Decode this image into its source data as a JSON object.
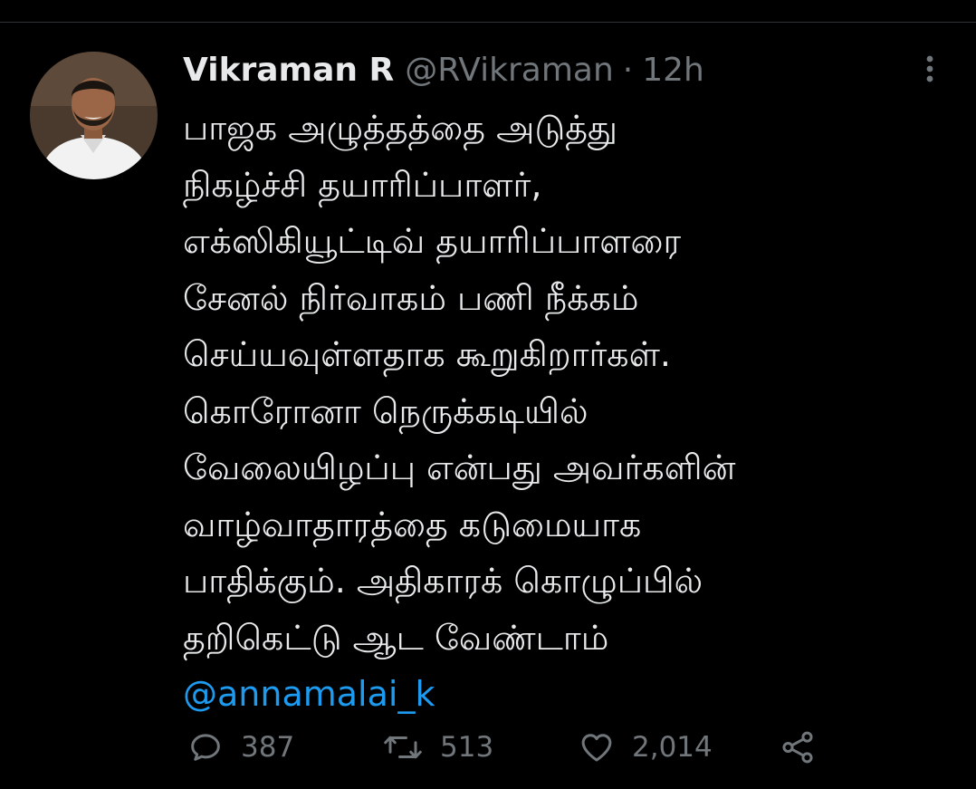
{
  "tweet": {
    "author": {
      "display_name": "Vikraman R",
      "handle": "@RVikraman",
      "avatar_icon": "profile-photo"
    },
    "separator": "·",
    "timestamp": "12h",
    "text_lines": [
      "பாஜக அழுத்தத்தை அடுத்து",
      "நிகழ்ச்சி தயாரிப்பாளர்,",
      "எக்ஸிகியூட்டிவ் தயாரிப்பாளரை",
      "சேனல் நிர்வாகம் பணி நீக்கம்",
      "செய்யவுள்ளதாக கூறுகிறார்கள்.",
      "கொரோனா நெருக்கடியில்",
      "வேலையிழப்பு என்பது அவர்களின்",
      "வாழ்வாதாரத்தை கடுமையாக",
      "பாதிக்கும். அதிகாரக் கொழுப்பில்",
      "தறிகெட்டு ஆட வேண்டாம்"
    ],
    "mention": "@annamalai_k",
    "more_icon": "more-vertical-icon"
  },
  "actions": {
    "reply": {
      "icon": "reply-icon",
      "count": "387"
    },
    "retweet": {
      "icon": "retweet-icon",
      "count": "513"
    },
    "like": {
      "icon": "heart-icon",
      "count": "2,014"
    },
    "share": {
      "icon": "share-icon"
    }
  },
  "colors": {
    "background": "#000000",
    "text": "#e7e9ea",
    "secondary_text": "#71767b",
    "link": "#1d9bf0",
    "divider": "#2f3336"
  }
}
